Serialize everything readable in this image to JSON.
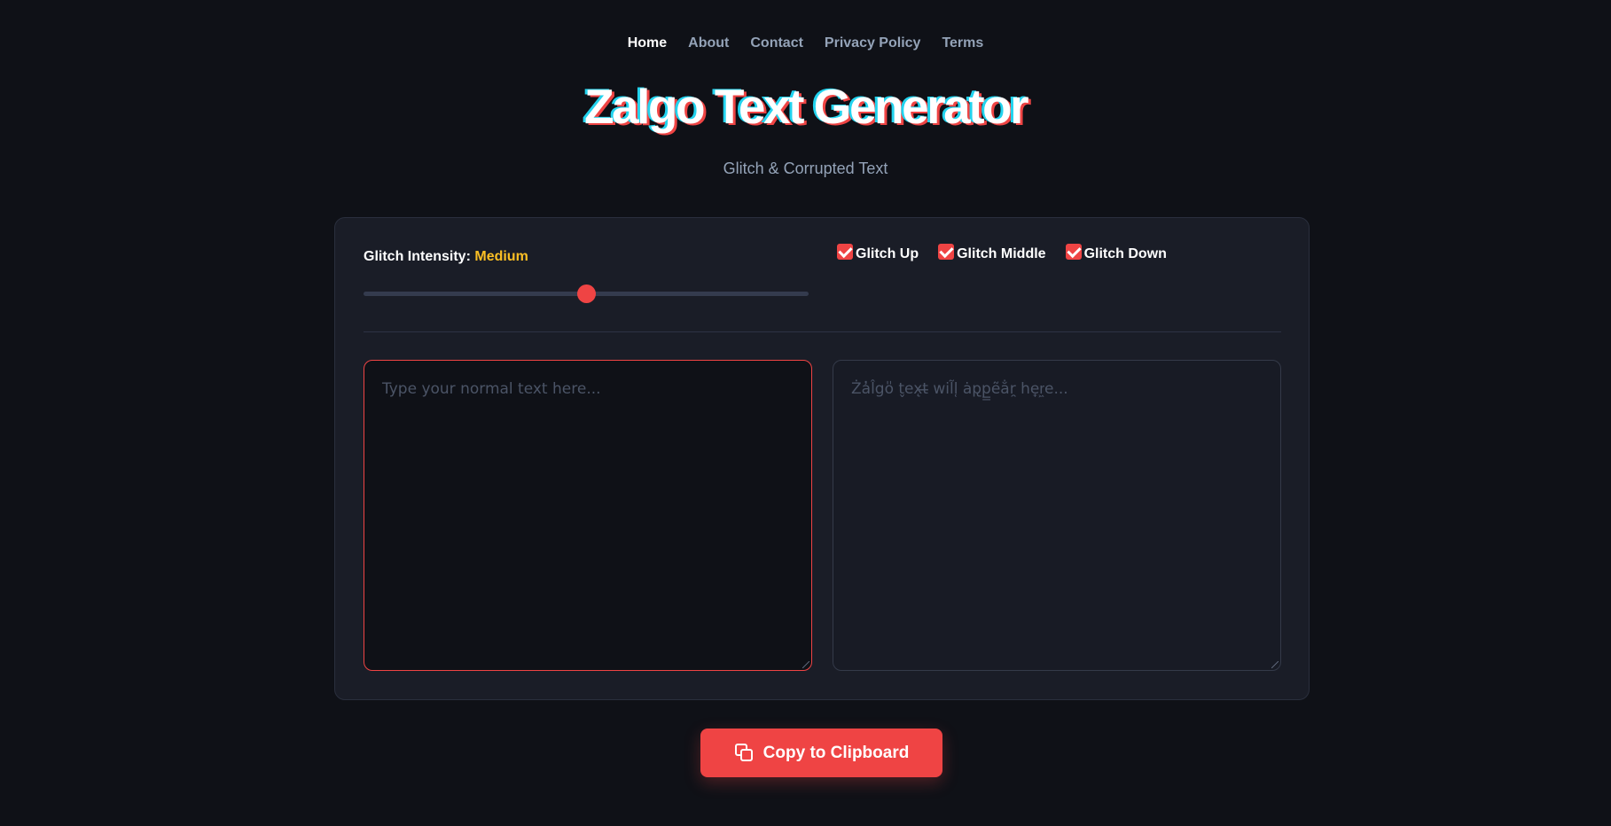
{
  "nav": {
    "items": [
      {
        "label": "Home",
        "active": true
      },
      {
        "label": "About"
      },
      {
        "label": "Contact"
      },
      {
        "label": "Privacy Policy"
      },
      {
        "label": "Terms"
      }
    ]
  },
  "header": {
    "title": "Zalgo Text Generator",
    "subtitle": "Glitch & Corrupted Text"
  },
  "controls": {
    "intensity_label": "Glitch Intensity:",
    "intensity_value": "Medium",
    "slider_fraction": 0.5,
    "checkboxes": [
      {
        "label": "Glitch Up",
        "checked": true
      },
      {
        "label": "Glitch Middle",
        "checked": true
      },
      {
        "label": "Glitch Down",
        "checked": true
      }
    ]
  },
  "editor": {
    "input_placeholder": "Type your normal text here...",
    "output_placeholder": "Ża̓l̂go̎ t̬ex̨t̶ wil̃l̜ ȧp̢p̳ẽa̐r̯ he̟r͖e..."
  },
  "actions": {
    "copy_label": "Copy to Clipboard"
  },
  "colors": {
    "accent": "#ef4444",
    "intensity_value": "#fbbf24",
    "background": "#0f1117",
    "panel": "#1a1d27"
  }
}
